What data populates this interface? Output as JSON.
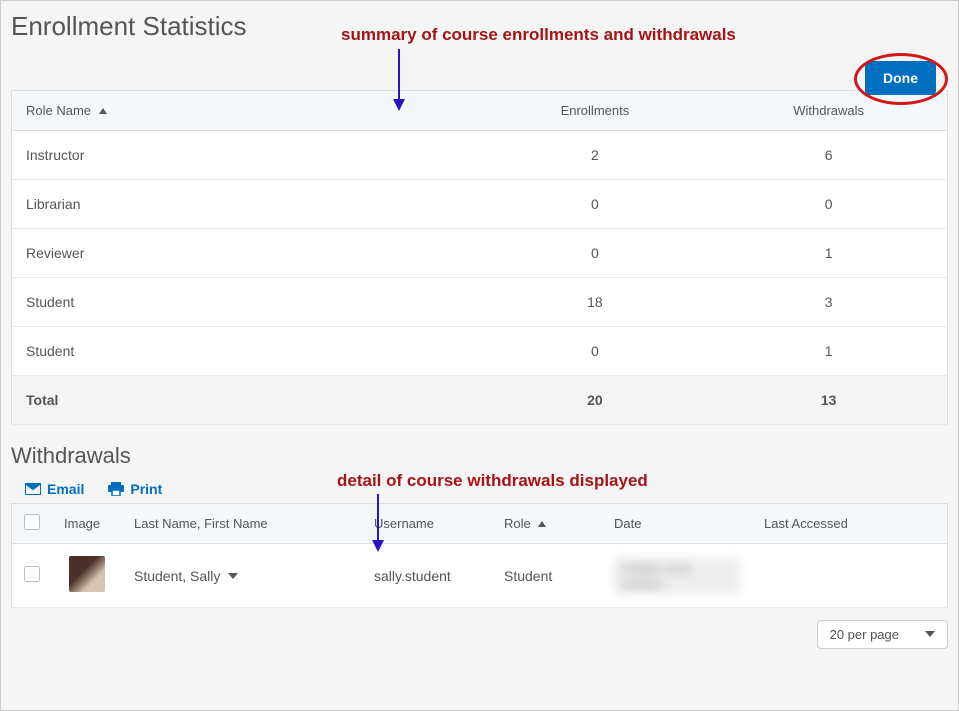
{
  "page": {
    "title": "Enrollment Statistics",
    "done_button": "Done"
  },
  "annotations": {
    "summary_label": "summary of course enrollments and withdrawals",
    "withdrawals_label": "detail of course withdrawals displayed"
  },
  "stats_table": {
    "columns": {
      "role": "Role Name",
      "enrollments": "Enrollments",
      "withdrawals": "Withdrawals"
    },
    "rows": [
      {
        "role": "Instructor",
        "enrollments": "2",
        "withdrawals": "6"
      },
      {
        "role": "Librarian",
        "enrollments": "0",
        "withdrawals": "0"
      },
      {
        "role": "Reviewer",
        "enrollments": "0",
        "withdrawals": "1"
      },
      {
        "role": "Student",
        "enrollments": "18",
        "withdrawals": "3"
      },
      {
        "role": "Student",
        "enrollments": "0",
        "withdrawals": "1"
      }
    ],
    "total_row": {
      "label": "Total",
      "enrollments": "20",
      "withdrawals": "13"
    }
  },
  "withdrawals_section": {
    "title": "Withdrawals",
    "actions": {
      "email": "Email",
      "print": "Print"
    },
    "columns": {
      "image": "Image",
      "name": "Last Name, First Name",
      "username": "Username",
      "role": "Role",
      "date": "Date",
      "last_accessed": "Last Accessed"
    },
    "rows": [
      {
        "name": "Student, Sally",
        "username": "sally.student",
        "role": "Student",
        "date": "",
        "last_accessed": ""
      }
    ],
    "pager_label": "20 per page"
  }
}
